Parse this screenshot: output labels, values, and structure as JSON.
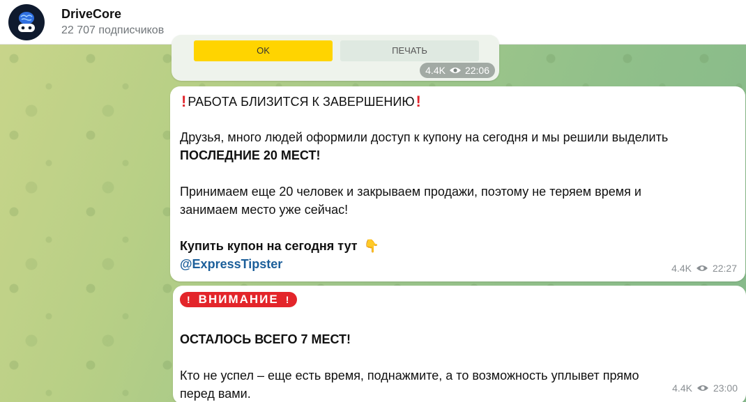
{
  "header": {
    "channel_name": "DriveCore",
    "subscribers": "22 707 подписчиков"
  },
  "messages": [
    {
      "buttons": {
        "ok": "OK",
        "print": "ПЕЧАТЬ"
      },
      "views": "4.4K",
      "time": "22:06"
    },
    {
      "title": "РАБОТА БЛИЗИТСЯ К ЗАВЕРШЕНИЮ",
      "p1_line1": "Друзья, много людей оформили доступ к купону на сегодня и мы решили выделить",
      "p1_line2": "ПОСЛЕДНИЕ 20 МЕСТ!",
      "p2_line1": "Принимаем еще 20 человек и закрываем продажи, поэтому не теряем время и",
      "p2_line2": "занимаем место уже сейчас!",
      "cta": "Купить купон на сегодня тут",
      "link": "@ExpressTipster",
      "views": "4.4K",
      "time": "22:27"
    },
    {
      "badge": "ВНИМАНИЕ",
      "headline": "ОСТАЛОСЬ ВСЕГО 7 МЕСТ!",
      "body_line1": "Кто не успел – еще есть время, поднажмите, а то возможность уплывет прямо",
      "body_line2": "перед вами.",
      "views": "4.4K",
      "time": "23:00"
    }
  ],
  "icons": {
    "eye": "eye-icon",
    "pointing_down": "pointing-down-icon",
    "exclamation": "exclamation-icon"
  },
  "colors": {
    "accent_yellow": "#ffd400",
    "warning_red": "#e3252a",
    "link_blue": "#1c5f9a"
  }
}
